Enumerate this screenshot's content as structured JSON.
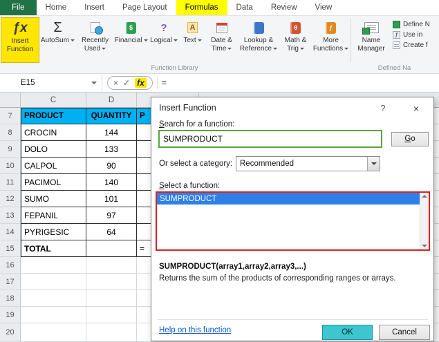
{
  "colors": {
    "file_tab_green": "#217346",
    "formulas_tab_yellow": "#FFFF00",
    "insert_function_highlight_yellow": "#FFE600",
    "table_header_cyan": "#00B0F0",
    "list_selection_blue": "#2E80E8",
    "search_box_border_green": "#58A53C",
    "list_border_red": "#D8201F",
    "ok_button_cyan": "#3EC6D0"
  },
  "icons": {
    "insert_function": "ƒx",
    "autosum": "Σ",
    "financial": "$",
    "logical": "?",
    "text": "A",
    "math_trig": "θ",
    "more_functions": "ƒ",
    "use_in_formula": "ƒ",
    "formula_cancel": "×",
    "formula_enter": "✓",
    "formula_fx": "fx",
    "dialog_help": "?",
    "dialog_close": "×"
  },
  "ribbon": {
    "tabs": [
      {
        "label": "File"
      },
      {
        "label": "Home"
      },
      {
        "label": "Insert"
      },
      {
        "label": "Page Layout"
      },
      {
        "label": "Formulas"
      },
      {
        "label": "Data"
      },
      {
        "label": "Review"
      },
      {
        "label": "View"
      }
    ],
    "function_library": {
      "group_label": "Function Library",
      "buttons": [
        {
          "label": "Insert Function"
        },
        {
          "label": "AutoSum"
        },
        {
          "label": "Recently Used"
        },
        {
          "label": "Financial"
        },
        {
          "label": "Logical"
        },
        {
          "label": "Text"
        },
        {
          "label": "Date & Time"
        },
        {
          "label": "Lookup & Reference"
        },
        {
          "label": "Math & Trig"
        },
        {
          "label": "More Functions"
        }
      ]
    },
    "defined_names": {
      "group_label": "Defined Na",
      "name_manager": "Name Manager",
      "items": [
        {
          "label": "Define N"
        },
        {
          "label": "Use in"
        },
        {
          "label": "Create f"
        }
      ]
    }
  },
  "formula_bar": {
    "name_box": "E15",
    "formula": "="
  },
  "sheet": {
    "column_headers": {
      "c": "C",
      "d": "D"
    },
    "rows": [
      {
        "num": "7",
        "c": "PRODUCT",
        "d": "QUANTITY",
        "e": "P"
      },
      {
        "num": "8",
        "c": "CROCIN",
        "d": "144",
        "e": ""
      },
      {
        "num": "9",
        "c": "DOLO",
        "d": "133",
        "e": ""
      },
      {
        "num": "10",
        "c": "CALPOL",
        "d": "90",
        "e": ""
      },
      {
        "num": "11",
        "c": "PACIMOL",
        "d": "140",
        "e": ""
      },
      {
        "num": "12",
        "c": "SUMO",
        "d": "101",
        "e": ""
      },
      {
        "num": "13",
        "c": "FEPANIL",
        "d": "97",
        "e": ""
      },
      {
        "num": "14",
        "c": "PYRIGESIC",
        "d": "64",
        "e": ""
      },
      {
        "num": "15",
        "c": "TOTAL",
        "d": "",
        "e": "="
      },
      {
        "num": "16"
      },
      {
        "num": "17"
      },
      {
        "num": "18"
      },
      {
        "num": "19"
      },
      {
        "num": "20"
      }
    ]
  },
  "dialog": {
    "title": "Insert Function",
    "search_label": "Search for a function:",
    "search_value": "SUMPRODUCT",
    "go_label": "Go",
    "category_label": "Or select a category:",
    "category_value": "Recommended",
    "select_label": "Select a function:",
    "functions": [
      {
        "name": "SUMPRODUCT",
        "selected": true
      }
    ],
    "signature": "SUMPRODUCT(array1,array2,array3,...)",
    "description": "Returns the sum of the products of corresponding ranges or arrays.",
    "help_link": "Help on this function",
    "ok_label": "OK",
    "cancel_label": "Cancel"
  }
}
